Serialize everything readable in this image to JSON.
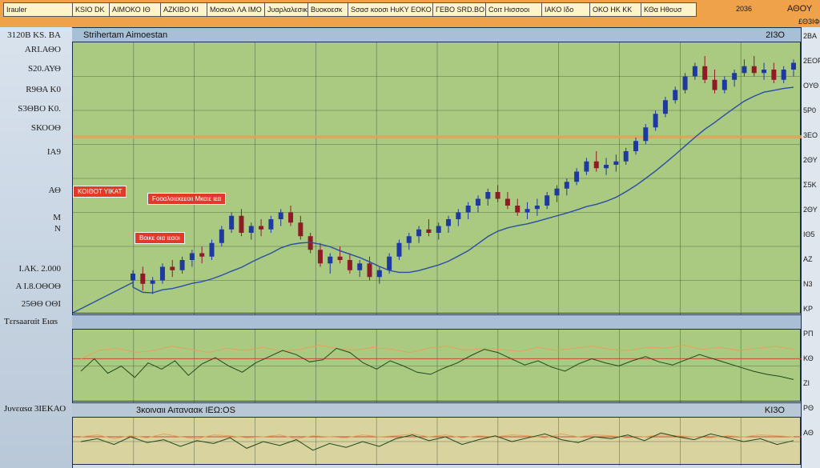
{
  "toolbar": {
    "cells": [
      "Irauler",
      "ΚSIO DK",
      "ΑΙΜΟΚΟ ΙΘ",
      "ΑΖΚΙΒΟ ΚΙ",
      "Μοσκολ ΛΑ ΙΜΟ",
      "Jυαρλαλεσικ",
      "Bυοκοεσκ",
      "Sσασ κοοσι ΗυΚΥ ΕΟΚΟ",
      "ΓΕΒΟ SRD.ΒΟ",
      "Cοιτ Ηισσοοι",
      "ΙΑΚΟ Ιδο",
      "ΟΚΟ ΗΚ ΚΚ",
      "ΚΘα Ηθουσ"
    ],
    "year": "2036",
    "right_top": "ΑΘΟΥ",
    "right_sub": "£Θ3ΙΦ"
  },
  "left_axis": [
    "3120Β ΚS. ΒΑ",
    "ΑRΙ.ΑΘΟ",
    "S20.ΑΥΘ",
    "R9ΘΑ Κ0",
    "S3ΘΒΟ Κ0.",
    "SΚΟΟΘ",
    "ΙΑ9",
    "ΑΘ",
    "Μ",
    "Ν",
    "Ι.ΑΚ. 2.000",
    "Α Ι.8.ΟΘΟΘ",
    "25ΘΘ ΟΘΙ"
  ],
  "right_axis": [
    "2ΒΑ",
    "2ΕΟΡ",
    "ΟΥΘ",
    "5Ρ0",
    "3ΕΟ",
    "2ΘΥ",
    "Σ5Κ",
    "2ΘΥ",
    "ΙΘ5",
    "ΑΖ",
    "Ν3",
    "ΚΡ",
    "ΡΠ",
    "ΚΘ",
    "ΖΙ",
    "ΡΘ",
    "ΑΘ"
  ],
  "main_pane": {
    "title": "Strihertam Aimoestan",
    "corner": "2Ι3Ο"
  },
  "tags": [
    "ΚΟΙΘΟΤ ΥΙΚΑΤ",
    "Fοοαλοιεκεεοιι Μκαιε ιεα",
    "Βοικε οια ιεαοι"
  ],
  "rsi_pane": {
    "title": "Tεrsaarαit Ειαs"
  },
  "stoch_pane": {
    "left_label": "Jυνεαsα 3ΙΕΚΑΟ",
    "title": "3κοιναιι Αιταναακ ΙΕΩ:ΟS",
    "corner": "ΚΙ3Ο"
  },
  "colors": {
    "up": "#1f3a9e",
    "down": "#8e1b25",
    "ma": "#2a4da6",
    "ref": "#e8a05a"
  },
  "chart_data": [
    {
      "type": "candlestick",
      "name": "price",
      "candles": [
        [
          100,
          103,
          98,
          102
        ],
        [
          102,
          104,
          97,
          99
        ],
        [
          99,
          101,
          96,
          100
        ],
        [
          100,
          105,
          99,
          104
        ],
        [
          104,
          106,
          101,
          103
        ],
        [
          103,
          107,
          102,
          106
        ],
        [
          106,
          109,
          104,
          108
        ],
        [
          108,
          110,
          105,
          107
        ],
        [
          107,
          112,
          106,
          111
        ],
        [
          111,
          116,
          110,
          115
        ],
        [
          115,
          120,
          114,
          119
        ],
        [
          119,
          121,
          113,
          114
        ],
        [
          114,
          117,
          112,
          116
        ],
        [
          116,
          118,
          113,
          115
        ],
        [
          115,
          119,
          114,
          118
        ],
        [
          118,
          121,
          116,
          120
        ],
        [
          120,
          122,
          116,
          117
        ],
        [
          117,
          119,
          112,
          113
        ],
        [
          113,
          114,
          108,
          109
        ],
        [
          109,
          111,
          104,
          105
        ],
        [
          105,
          108,
          102,
          107
        ],
        [
          107,
          110,
          105,
          106
        ],
        [
          106,
          108,
          102,
          103
        ],
        [
          103,
          106,
          101,
          105
        ],
        [
          105,
          107,
          100,
          101
        ],
        [
          101,
          104,
          99,
          103
        ],
        [
          103,
          108,
          102,
          107
        ],
        [
          107,
          112,
          106,
          111
        ],
        [
          111,
          114,
          109,
          113
        ],
        [
          113,
          116,
          111,
          115
        ],
        [
          115,
          118,
          113,
          114
        ],
        [
          114,
          117,
          112,
          116
        ],
        [
          116,
          119,
          114,
          118
        ],
        [
          118,
          121,
          116,
          120
        ],
        [
          120,
          123,
          118,
          122
        ],
        [
          122,
          125,
          120,
          124
        ],
        [
          124,
          127,
          122,
          126
        ],
        [
          126,
          128,
          123,
          124
        ],
        [
          124,
          126,
          121,
          122
        ],
        [
          122,
          124,
          119,
          120
        ],
        [
          120,
          123,
          118,
          121
        ],
        [
          121,
          124,
          119,
          122
        ],
        [
          122,
          126,
          121,
          125
        ],
        [
          125,
          128,
          123,
          127
        ],
        [
          127,
          130,
          125,
          129
        ],
        [
          129,
          133,
          128,
          132
        ],
        [
          132,
          136,
          131,
          135
        ],
        [
          135,
          138,
          132,
          133
        ],
        [
          133,
          136,
          131,
          134
        ],
        [
          134,
          137,
          132,
          135
        ],
        [
          135,
          139,
          134,
          138
        ],
        [
          138,
          142,
          137,
          141
        ],
        [
          141,
          146,
          140,
          145
        ],
        [
          145,
          150,
          144,
          149
        ],
        [
          149,
          154,
          148,
          153
        ],
        [
          153,
          157,
          152,
          156
        ],
        [
          156,
          161,
          155,
          160
        ],
        [
          160,
          164,
          159,
          163
        ],
        [
          163,
          166,
          158,
          159
        ],
        [
          159,
          162,
          155,
          156
        ],
        [
          156,
          160,
          155,
          159
        ],
        [
          159,
          162,
          157,
          161
        ],
        [
          161,
          165,
          160,
          163
        ],
        [
          163,
          166,
          160,
          161
        ],
        [
          161,
          164,
          159,
          162
        ],
        [
          162,
          164,
          158,
          159
        ],
        [
          159,
          163,
          158,
          162
        ],
        [
          162,
          165,
          160,
          164
        ]
      ],
      "ylim": [
        90,
        170
      ]
    },
    {
      "type": "line",
      "name": "rsi",
      "values": [
        50,
        62,
        48,
        55,
        44,
        58,
        52,
        60,
        46,
        57,
        63,
        55,
        49,
        58,
        64,
        70,
        66,
        59,
        61,
        72,
        68,
        58,
        52,
        60,
        55,
        49,
        47,
        53,
        58,
        65,
        71,
        68,
        62,
        56,
        60,
        54,
        50,
        57,
        62,
        58,
        55,
        60,
        64,
        59,
        56,
        61,
        66,
        62,
        58,
        54,
        50,
        47,
        45,
        42
      ],
      "reference": [
        62,
        70,
        72,
        68,
        70,
        74,
        71,
        68,
        72,
        70,
        73,
        69,
        71,
        75,
        72,
        70,
        73,
        71,
        68,
        72,
        74,
        70,
        72,
        71,
        69,
        73,
        70,
        72,
        74,
        71,
        70,
        73,
        72,
        75,
        71,
        73,
        70,
        72,
        74,
        71
      ],
      "ylim": [
        20,
        90
      ]
    },
    {
      "type": "line",
      "name": "stochastic",
      "values": [
        55,
        58,
        52,
        60,
        54,
        57,
        50,
        56,
        53,
        59,
        48,
        55,
        51,
        57,
        46,
        53,
        49,
        55,
        50,
        58,
        62,
        56,
        60,
        52,
        57,
        61,
        55,
        59,
        63,
        57,
        54,
        60,
        58,
        62,
        56,
        64,
        60,
        57,
        63,
        59,
        55,
        58,
        52,
        56
      ],
      "reference": [
        60,
        62,
        58,
        61,
        59,
        63,
        60,
        58,
        62,
        61,
        59,
        60,
        62,
        58,
        61,
        60,
        59,
        62,
        60,
        61,
        63,
        60,
        62,
        59,
        61,
        60,
        62,
        61,
        59,
        63,
        60,
        62,
        61,
        59,
        60,
        62,
        61,
        60,
        59,
        61,
        60,
        62,
        61,
        60
      ],
      "ylim": [
        30,
        80
      ]
    }
  ]
}
